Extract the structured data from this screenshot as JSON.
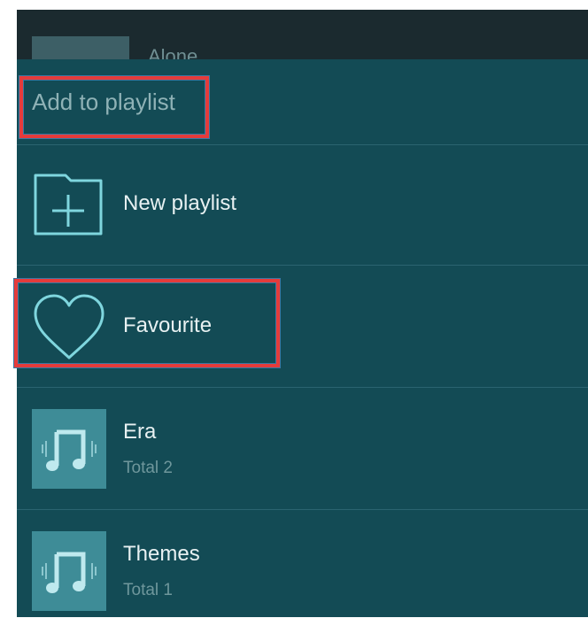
{
  "background_track": {
    "title": "Alone"
  },
  "dialog": {
    "title": "Add to playlist",
    "items": [
      {
        "label": "New playlist",
        "icon": "folder-plus-icon"
      },
      {
        "label": "Favourite",
        "icon": "heart-icon"
      },
      {
        "label": "Era",
        "subtitle": "Total 2",
        "icon": "music-note-icon"
      },
      {
        "label": "Themes",
        "subtitle": "Total 1",
        "icon": "music-note-icon"
      }
    ]
  },
  "colors": {
    "sheet_bg": "#134b55",
    "icon_stroke": "#7fd6de",
    "highlight": "#e53b3b"
  }
}
